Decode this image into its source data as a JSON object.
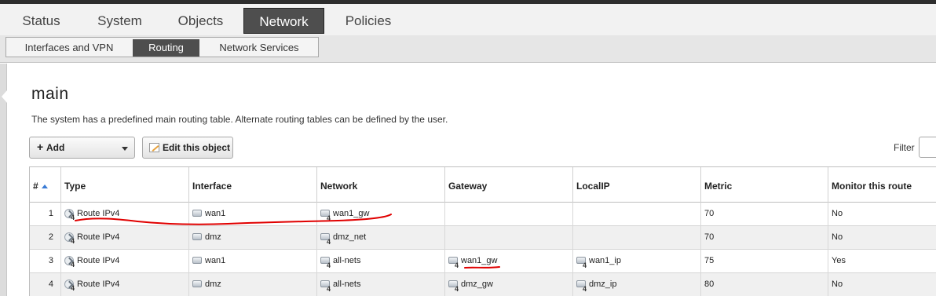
{
  "top_nav": {
    "tabs": [
      "Status",
      "System",
      "Objects",
      "Network",
      "Policies"
    ],
    "active": "Network"
  },
  "sub_nav": {
    "tabs": [
      "Interfaces and VPN",
      "Routing",
      "Network Services"
    ],
    "active": "Routing"
  },
  "page": {
    "title": "main",
    "description": "The system has a predefined main routing table. Alternate routing tables can be defined by the user."
  },
  "toolbar": {
    "add_label": "Add",
    "edit_label": "Edit this object",
    "filter_label": "Filter"
  },
  "table": {
    "headers": [
      "#",
      "Type",
      "Interface",
      "Network",
      "Gateway",
      "LocalIP",
      "Metric",
      "Monitor this route"
    ],
    "rows": [
      {
        "num": "1",
        "type": "Route IPv4",
        "interface": "wan1",
        "network": "wan1_gw",
        "gateway": "",
        "localip": "",
        "metric": "70",
        "monitor": "No"
      },
      {
        "num": "2",
        "type": "Route IPv4",
        "interface": "dmz",
        "network": "dmz_net",
        "gateway": "",
        "localip": "",
        "metric": "70",
        "monitor": "No"
      },
      {
        "num": "3",
        "type": "Route IPv4",
        "interface": "wan1",
        "network": "all-nets",
        "gateway": "wan1_gw",
        "localip": "wan1_ip",
        "metric": "75",
        "monitor": "Yes"
      },
      {
        "num": "4",
        "type": "Route IPv4",
        "interface": "dmz",
        "network": "all-nets",
        "gateway": "dmz_gw",
        "localip": "dmz_ip",
        "metric": "80",
        "monitor": "No"
      }
    ]
  },
  "icons": {
    "route": "route-icon",
    "object": "address-object-icon",
    "sort": "sort-ascending-icon",
    "add": "plus-icon",
    "dropdown": "chevron-down-icon",
    "edit": "edit-icon"
  },
  "colors": {
    "active_tab": "#4e4e4e",
    "annotation": "#e00000",
    "sort_arrow": "#3a7bd5"
  }
}
